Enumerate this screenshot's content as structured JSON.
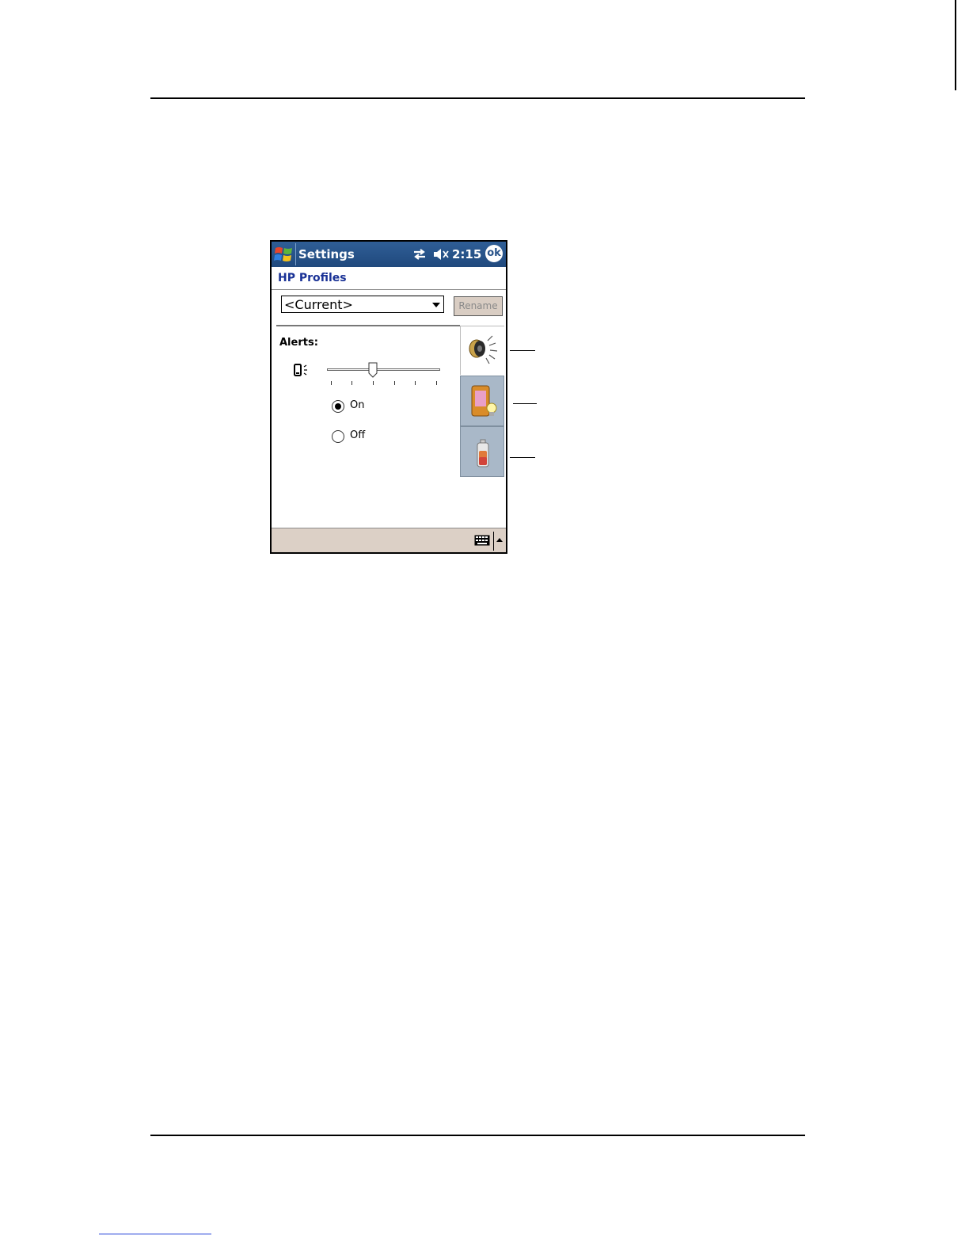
{
  "window": {
    "title": "Settings",
    "clock": "2:15",
    "ok_label": "ok"
  },
  "app": {
    "header": "HP Profiles",
    "profile_value": "<Current>",
    "rename_label": "Rename"
  },
  "alerts": {
    "label": "Alerts:",
    "volume_level": 0.4,
    "radio_on_label": "On",
    "radio_off_label": "Off",
    "selected": "On"
  },
  "tabs": [
    {
      "name": "sound",
      "icon": "speaker-icon",
      "active": true
    },
    {
      "name": "display",
      "icon": "device-backlight-icon",
      "active": false
    },
    {
      "name": "power",
      "icon": "battery-icon",
      "active": false
    }
  ],
  "icons": {
    "start": "windows-flag-icon",
    "sync": "sync-arrows-icon",
    "volume": "speaker-muted-icon",
    "vibrate": "vibrate-icon",
    "keyboard": "keyboard-icon"
  },
  "colors": {
    "titlebar": "#2a548a",
    "header_text": "#1a3296",
    "bottombar": "#dcd0c6",
    "inactive_tab": "#a9b8c8"
  }
}
